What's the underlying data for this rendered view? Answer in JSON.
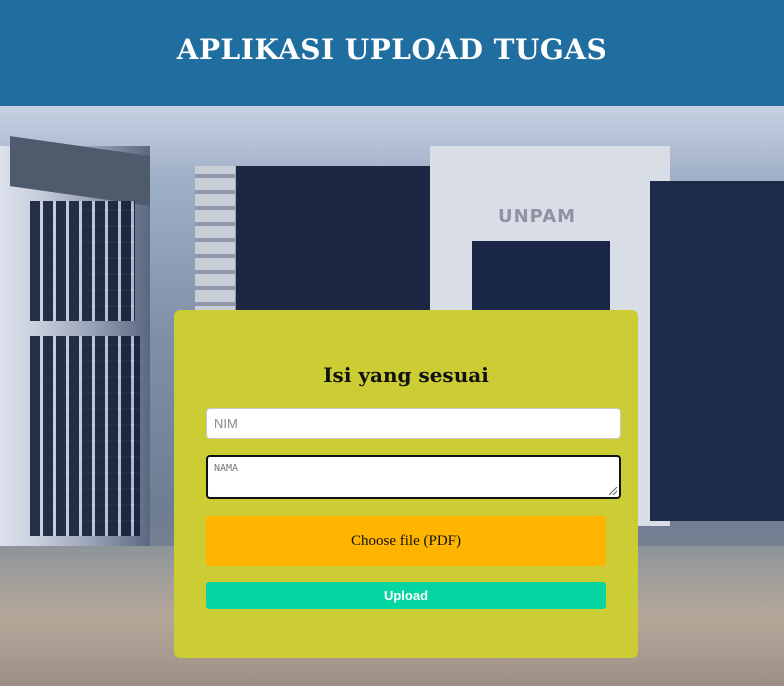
{
  "header": {
    "title": "APLIKASI UPLOAD TUGAS"
  },
  "background": {
    "building_sign": "UNPAM"
  },
  "form": {
    "heading": "Isi yang sesuai",
    "nim": {
      "placeholder": "NIM",
      "value": ""
    },
    "nama": {
      "placeholder": "NAMA",
      "value": ""
    },
    "file_button_label": "Choose file (PDF)",
    "upload_button_label": "Upload"
  },
  "colors": {
    "header_bg": "#206ea0",
    "card_bg": "#cccd35",
    "file_button_bg": "#ffb400",
    "upload_button_bg": "#05d6a1"
  }
}
